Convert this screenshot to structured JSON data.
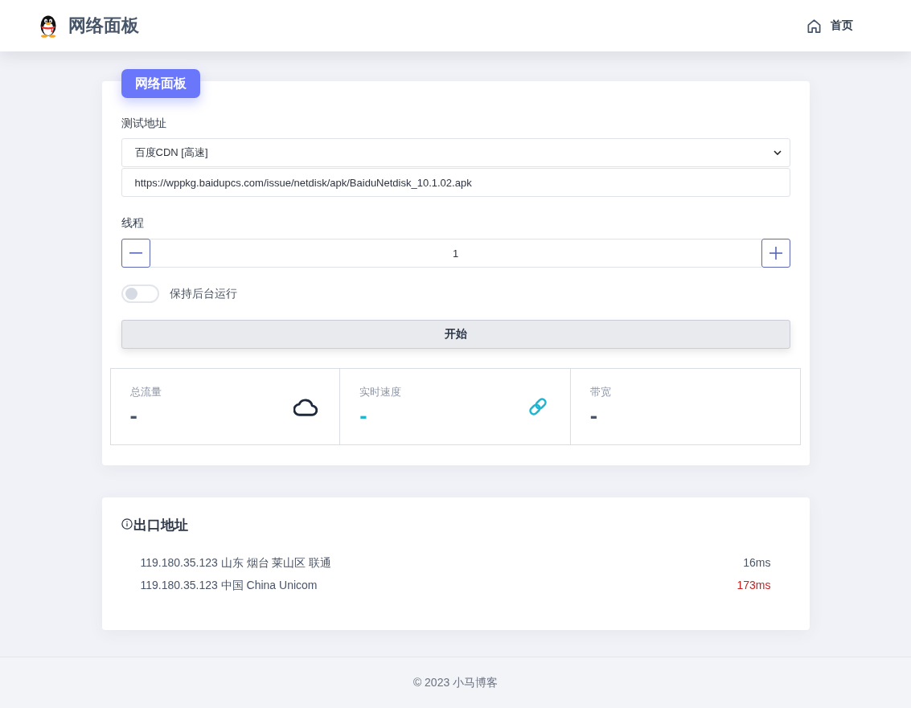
{
  "header": {
    "title": "网络面板",
    "nav": [
      {
        "label": "首页"
      }
    ]
  },
  "panel": {
    "badge": "网络面板",
    "test_address": {
      "label": "测试地址",
      "select_value": "百度CDN [高速]",
      "url_value": "https://wppkg.baidupcs.com/issue/netdisk/apk/BaiduNetdisk_10.1.02.apk"
    },
    "threads": {
      "label": "线程",
      "value": "1"
    },
    "background_toggle": {
      "label": "保持后台运行",
      "on": false
    },
    "start_button": "开始",
    "stats": [
      {
        "label": "总流量",
        "value": "-"
      },
      {
        "label": "实时速度",
        "value": "-"
      },
      {
        "label": "带宽",
        "value": "-"
      }
    ]
  },
  "exit_addresses": {
    "title": "出口地址",
    "rows": [
      {
        "address": "119.180.35.123 山东 烟台 莱山区 联通",
        "latency": "16ms",
        "color": "#4a5568"
      },
      {
        "address": "119.180.35.123 中国 China Unicom",
        "latency": "173ms",
        "color": "#c81e1e"
      }
    ]
  },
  "footer": "© 2023 小马博客"
}
